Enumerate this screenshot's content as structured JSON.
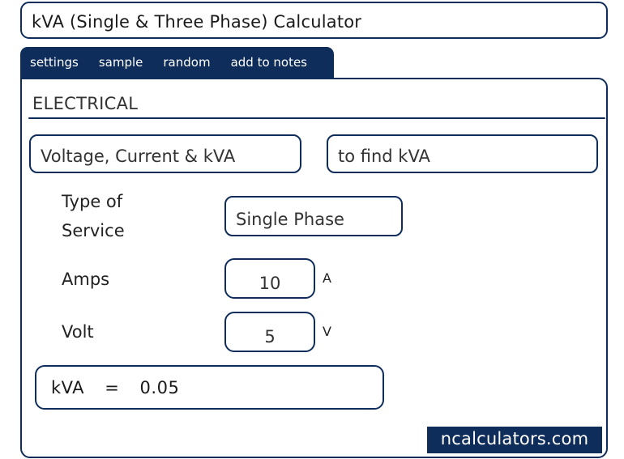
{
  "title": "kVA (Single & Three Phase) Calculator",
  "tabs": [
    "settings",
    "sample",
    "random",
    "add to notes"
  ],
  "section": "ELECTRICAL",
  "selectors": {
    "calc_mode": "Voltage, Current & kVA",
    "target": "to find kVA"
  },
  "fields": {
    "service_label": "Type of Service",
    "service_value": "Single Phase",
    "amps_label": "Amps",
    "amps_value": "10",
    "amps_unit": "A",
    "volt_label": "Volt",
    "volt_value": "5",
    "volt_unit": "V"
  },
  "result": {
    "label": "kVA",
    "eq": "=",
    "value": "0.05"
  },
  "brand": "ncalculators.com",
  "colors": {
    "accent": "#0f2d5a",
    "background": "#ffffff"
  }
}
